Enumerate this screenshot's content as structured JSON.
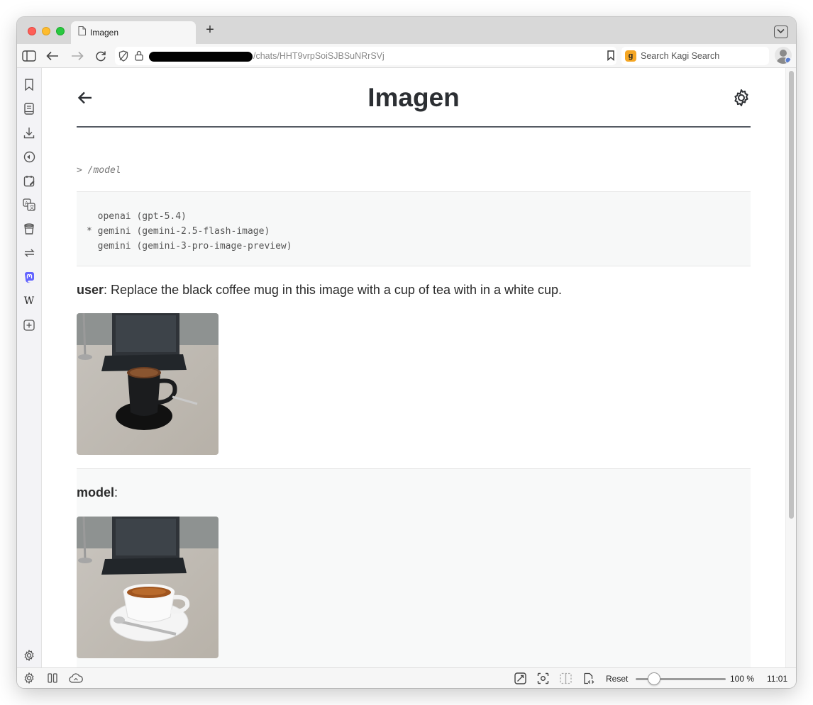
{
  "browser": {
    "tab_title": "Imagen",
    "new_tab_label": "+",
    "url_visible": "/chats/HHT9vrpSoiSJBSuNRrSVj",
    "search_placeholder": "Search Kagi Search",
    "kagi_logo_letter": "g"
  },
  "sidebar": {
    "items": [
      "bookmarks-icon",
      "reading-list-icon",
      "downloads-icon",
      "history-icon",
      "notes-icon",
      "translate-icon",
      "reader-icon",
      "sync-icon",
      "mastodon-icon",
      "wikipedia-icon",
      "add-panel-icon"
    ],
    "wikipedia_glyph": "W"
  },
  "page": {
    "title": "Imagen",
    "command": "> /model",
    "models_text": "  openai (gpt-5.4)\n* gemini (gemini-2.5-flash-image)\n  gemini (gemini-3-pro-image-preview)",
    "user_label": "user",
    "user_message": ": Replace the black coffee mug in this image with a cup of tea with in a white cup.",
    "model_label": "model",
    "model_suffix": ":"
  },
  "statusbar": {
    "reset_label": "Reset",
    "zoom_value": "100 %",
    "zoom_level": 1.0,
    "clock": "11:01"
  },
  "colors": {
    "accent_mastodon": "#6364ff",
    "kagi_brand": "#f5a623",
    "title_text": "#2c2f33"
  }
}
